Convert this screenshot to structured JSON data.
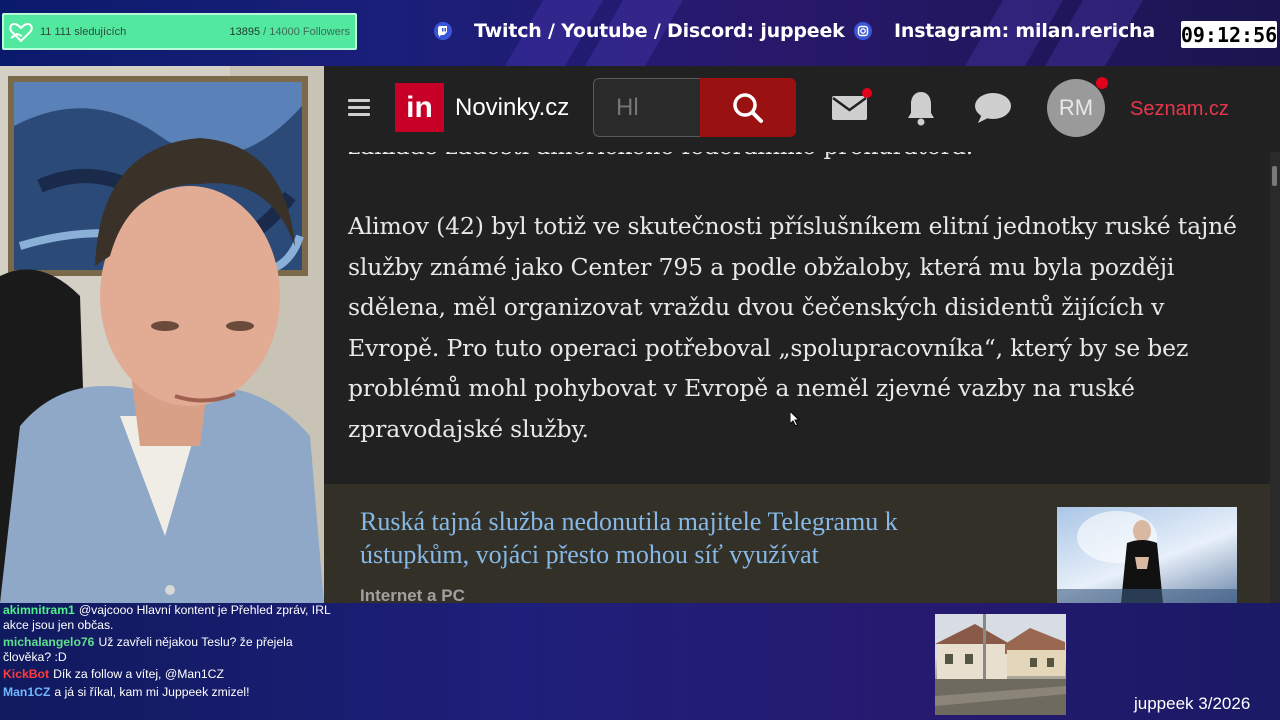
{
  "colors": {
    "follow_widget_bg": "#52e8a0",
    "novinky_red": "#c80028",
    "search_btn": "#9a1111",
    "seznam_link": "#e8374b",
    "related_link": "#86b8e8",
    "notification_dot": "#e3001b"
  },
  "overlay": {
    "follower_widget": {
      "label": "11 111 sledujících",
      "current": "13895",
      "goal": "/ 14000 Followers",
      "icon": "heart-hand-icon"
    },
    "socials": [
      {
        "icon": "twitch-icon",
        "text": "Twitch / Youtube / Discord: juppeek"
      },
      {
        "icon": "instagram-icon",
        "text": "Instagram: milan.rericha"
      }
    ],
    "clock": "09:12:56",
    "watermark": "juppeek 3/2026"
  },
  "browser": {
    "logo_letters": "in",
    "site_name": "Novinky.cz",
    "search_placeholder": "Hl",
    "search_icon": "search-icon",
    "nav_icons": [
      "mail-icon",
      "bell-icon",
      "chat-bubble-icon"
    ],
    "avatar_initials": "RM",
    "partner_link": "Seznam.cz",
    "article": {
      "cut_line": "základě žádosti amerického federálního prokurátora.",
      "paragraph": "Alimov (42) byl totiž ve skutečnosti příslušníkem elitní jednotky ruské tajné služby známé jako Center 795 a podle obžaloby, která mu byla později sdělena, měl organizovat vraždu dvou čečenských disidentů žijících v Evropě. Pro tuto operaci potřeboval „spolupracovníka“, který by se bez problémů mohl pohybovat v Evropě a neměl zjevné vazby na ruské zpravodajské služby."
    },
    "related": {
      "title": "Ruská tajná služba nedonutila majitele Telegramu k ústupkům, vojáci přesto mohou síť využívat",
      "category": "Internet a PC"
    }
  },
  "chat": [
    {
      "user": "akimnitram1",
      "color": "#4ef08a",
      "text": "@vajcooo Hlavní kontent je Přehled zpráv, IRL akce jsou jen občas."
    },
    {
      "user": "michalangelo76",
      "color": "#5ee08e",
      "text": "Už zavřeli nějakou Teslu? že přejela člověka? :D"
    },
    {
      "user": "KickBot",
      "color": "#ff3b3b",
      "text": "Dík za follow a vítej, @Man1CZ"
    },
    {
      "user": "Man1CZ",
      "color": "#6fb8ff",
      "text": "a já si říkal, kam mi Juppeek zmizel!"
    }
  ]
}
